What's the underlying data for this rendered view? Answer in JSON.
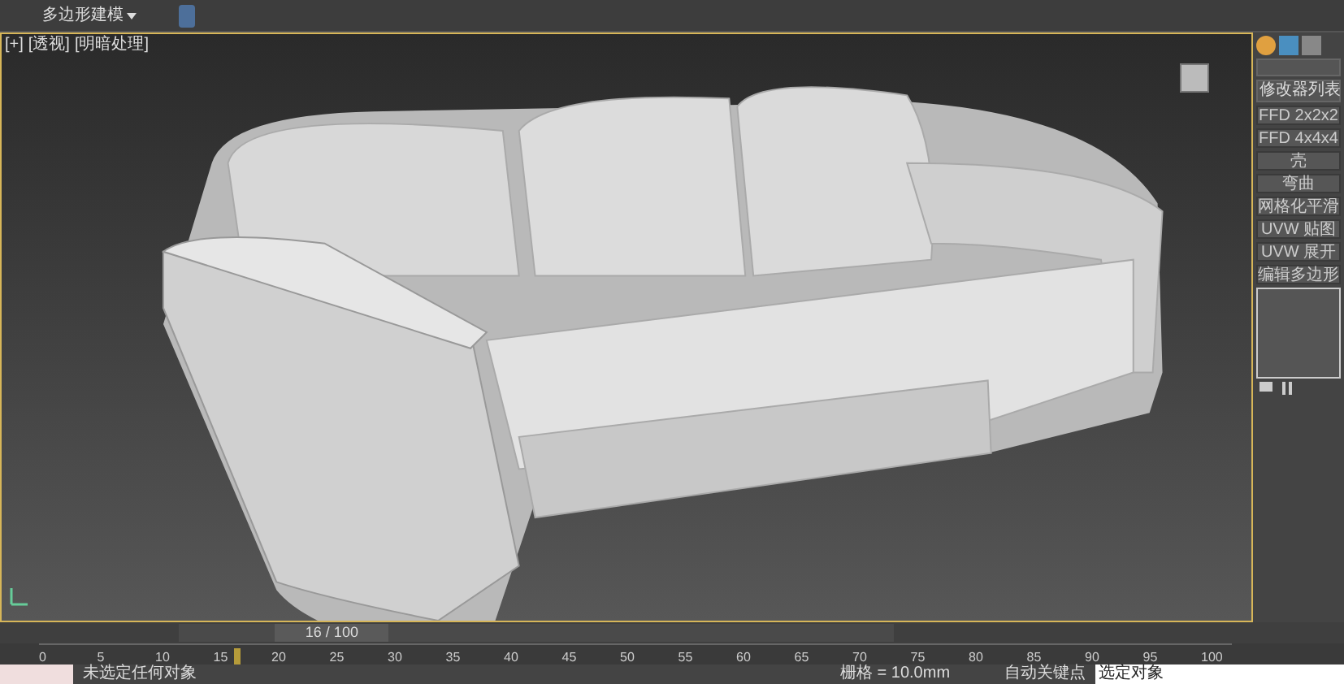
{
  "ribbon": {
    "label": "多边形建模"
  },
  "viewport": {
    "labels": [
      "[+]",
      "[透视]",
      "[明暗处理]"
    ]
  },
  "command_panel": {
    "modifier_list": "修改器列表",
    "modifiers": [
      {
        "label": "FFD 2x2x2"
      },
      {
        "label": "FFD 4x4x4"
      },
      {
        "label": "壳"
      },
      {
        "label": "弯曲"
      },
      {
        "label": "网格化平滑"
      },
      {
        "label": "UVW 贴图"
      },
      {
        "label": "UVW 展开"
      },
      {
        "label": "编辑多边形"
      }
    ]
  },
  "time_slider": {
    "label": "16 / 100",
    "level": 0.16
  },
  "timeline": {
    "ticks": [
      "0",
      "5",
      "10",
      "15",
      "20",
      "25",
      "30",
      "35",
      "40",
      "45",
      "50",
      "55",
      "60",
      "65",
      "70",
      "75",
      "80",
      "85",
      "90",
      "95",
      "100"
    ]
  },
  "status_bar": {
    "prompt": "未选定任何对象",
    "grid": "栅格 = 10.0mm",
    "auto_key": "自动关键点",
    "selection": "选定对象"
  }
}
